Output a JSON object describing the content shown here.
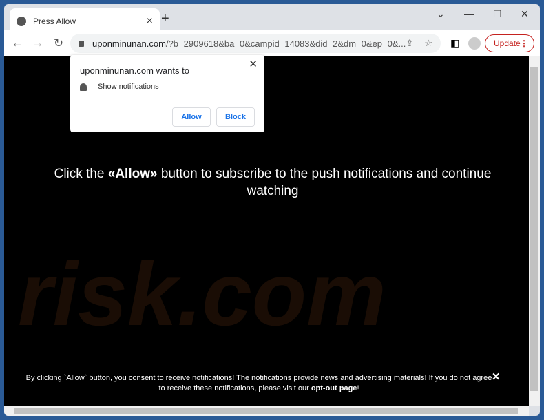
{
  "tab": {
    "title": "Press Allow",
    "icon": "globe-icon"
  },
  "window_controls": {
    "list": "⌄",
    "minimize": "—",
    "maximize": "☐",
    "close": "✕"
  },
  "toolbar": {
    "url_host": "uponminunan.com",
    "url_rest": "/?b=2909618&ba=0&campid=14083&did=2&dm=0&ep=0&...",
    "update_label": "Update"
  },
  "popup": {
    "title": "uponminunan.com wants to",
    "permission": "Show notifications",
    "allow": "Allow",
    "block": "Block"
  },
  "page": {
    "headline_pre": "Click the ",
    "headline_bold": "«Allow»",
    "headline_post": " button to subscribe to the push notifications and continue watching",
    "watermark": "risk.com",
    "footer_text": "By clicking `Allow` button, you consent to receive notifications! The notifications provide news and advertising materials! If you do not agree to receive these notifications, please visit our ",
    "footer_link": "opt-out page",
    "footer_end": "!"
  },
  "colors": {
    "update": "#c5221f",
    "link_blue": "#1a73e8",
    "frame": "#2a5a96"
  }
}
